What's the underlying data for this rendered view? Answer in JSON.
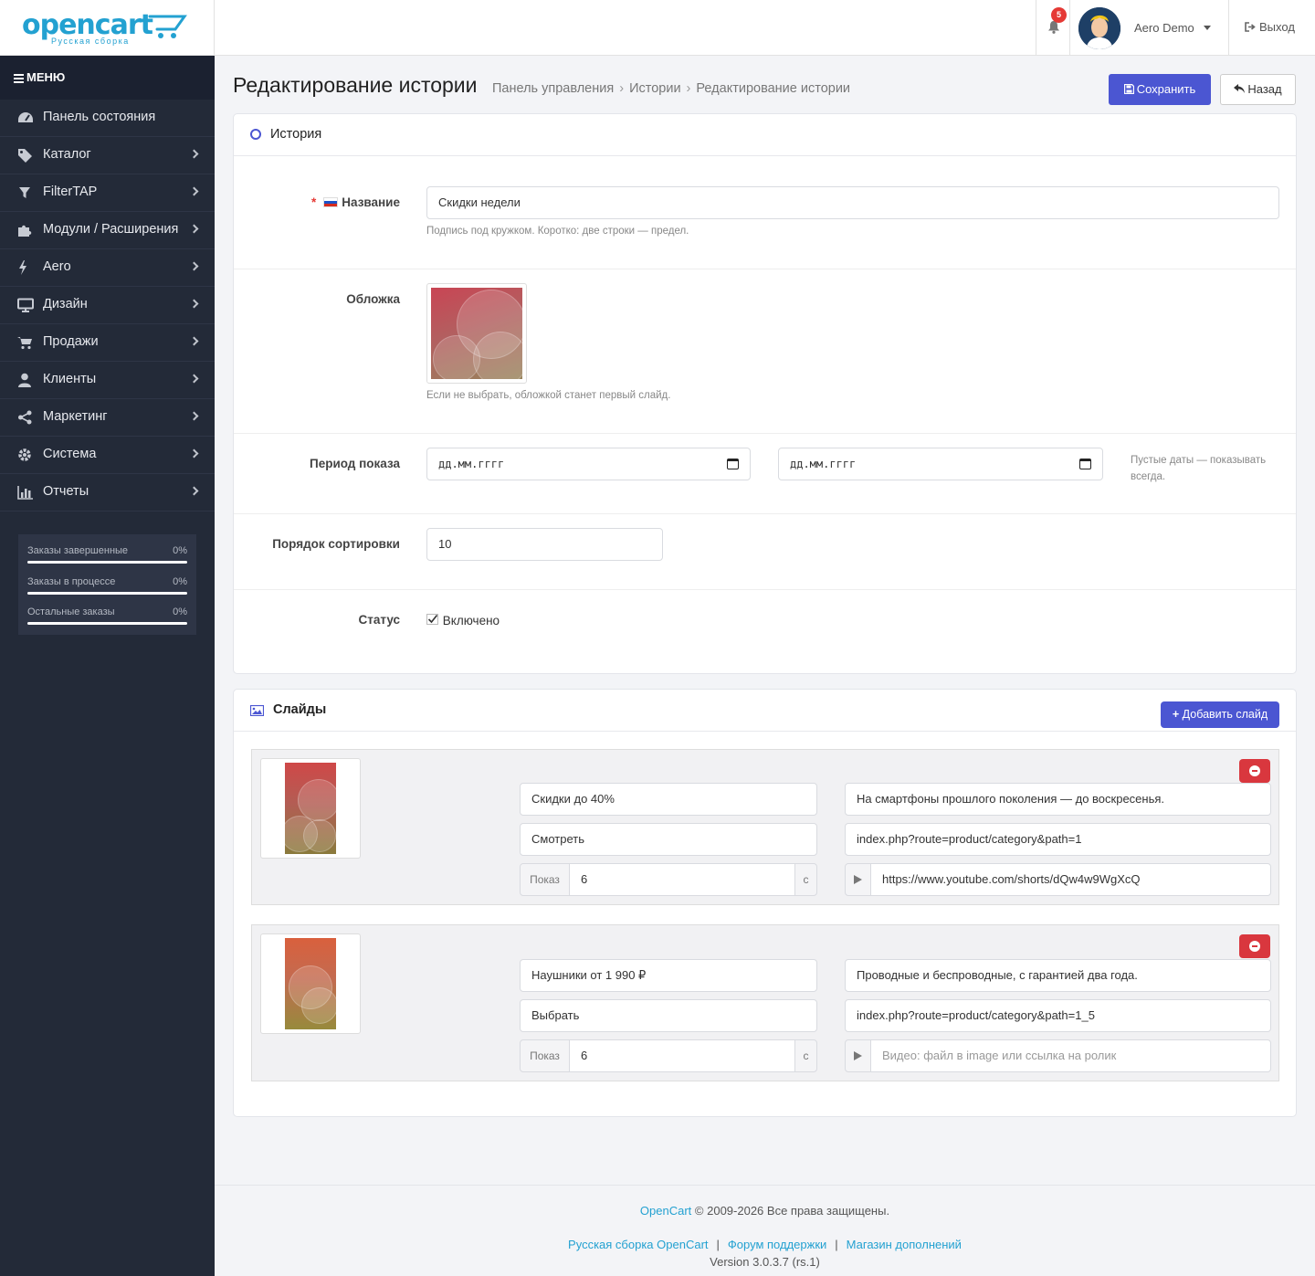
{
  "header": {
    "logo_text": "opencart",
    "logo_subtitle": "Русская сборка",
    "notification_count": "5",
    "user_name": "Aero Demo",
    "logout_label": "Выход"
  },
  "sidebar": {
    "menu_title": "МЕНЮ",
    "items": [
      {
        "label": "Панель состояния",
        "icon": "dashboard-icon",
        "has_submenu": false
      },
      {
        "label": "Каталог",
        "icon": "tags-icon",
        "has_submenu": true
      },
      {
        "label": "FilterTAP",
        "icon": "filter-icon",
        "has_submenu": true
      },
      {
        "label": "Модули / Расширения",
        "icon": "puzzle-icon",
        "has_submenu": true
      },
      {
        "label": "Aero",
        "icon": "bolt-icon",
        "has_submenu": true
      },
      {
        "label": "Дизайн",
        "icon": "monitor-icon",
        "has_submenu": true
      },
      {
        "label": "Продажи",
        "icon": "cart-icon",
        "has_submenu": true
      },
      {
        "label": "Клиенты",
        "icon": "user-icon",
        "has_submenu": true
      },
      {
        "label": "Маркетинг",
        "icon": "share-icon",
        "has_submenu": true
      },
      {
        "label": "Система",
        "icon": "gear-icon",
        "has_submenu": true
      },
      {
        "label": "Отчеты",
        "icon": "bar-chart-icon",
        "has_submenu": true
      }
    ],
    "stats": [
      {
        "label": "Заказы завершенные",
        "value": "0%",
        "fraction": 0
      },
      {
        "label": "Заказы в процессе",
        "value": "0%",
        "fraction": 0
      },
      {
        "label": "Остальные заказы",
        "value": "0%",
        "fraction": 0
      }
    ]
  },
  "page": {
    "title": "Редактирование истории",
    "breadcrumb": [
      "Панель управления",
      "Истории",
      "Редактирование истории"
    ],
    "save_label": "Сохранить",
    "back_label": "Назад"
  },
  "story_panel": {
    "title": "История",
    "name_label": "Название",
    "name_value": "Скидки недели",
    "name_help": "Подпись под кружком. Коротко: две строки — предел.",
    "cover_label": "Обложка",
    "cover_help": "Если не выбрать, обложкой станет первый слайд.",
    "period_label": "Период показа",
    "date_from": "дд.мм.гггг",
    "date_to": "дд.мм.гггг",
    "period_help": "Пустые даты — показывать всегда.",
    "sort_label": "Порядок сортировки",
    "sort_value": "10",
    "status_label": "Статус",
    "status_checkbox_label": "Включено",
    "status_checked": true
  },
  "slides_panel": {
    "title": "Слайды",
    "add_label": "Добавить слайд",
    "slides": [
      {
        "title": "Скидки до 40%",
        "description": "На смартфоны прошлого поколения — до воскресенья.",
        "button_text": "Смотреть",
        "link": "index.php?route=product/category&path=1",
        "duration_prefix": "Показ",
        "duration": "6",
        "duration_suffix": "с",
        "video": "https://www.youtube.com/shorts/dQw4w9WgXcQ",
        "video_placeholder": "Видео: файл в image или ссылка на ролик"
      },
      {
        "title": "Наушники от 1 990 ₽",
        "description": "Проводные и беспроводные, с гарантией два года.",
        "button_text": "Выбрать",
        "link": "index.php?route=product/category&path=1_5",
        "duration_prefix": "Показ",
        "duration": "6",
        "duration_suffix": "с",
        "video": "",
        "video_placeholder": "Видео: файл в image или ссылка на ролик"
      }
    ]
  },
  "footer": {
    "brand_link": "OpenCart",
    "copyright": "© 2009-2026 Все права защищены.",
    "links": [
      "Русская сборка OpenCart",
      "Форум поддержки",
      "Магазин дополнений"
    ],
    "version": "Version 3.0.3.7 (rs.1)"
  },
  "colors": {
    "accent": "#4b56d2",
    "brand": "#23a1d1",
    "sidebar_bg": "#232a38",
    "danger": "#d9373e"
  }
}
